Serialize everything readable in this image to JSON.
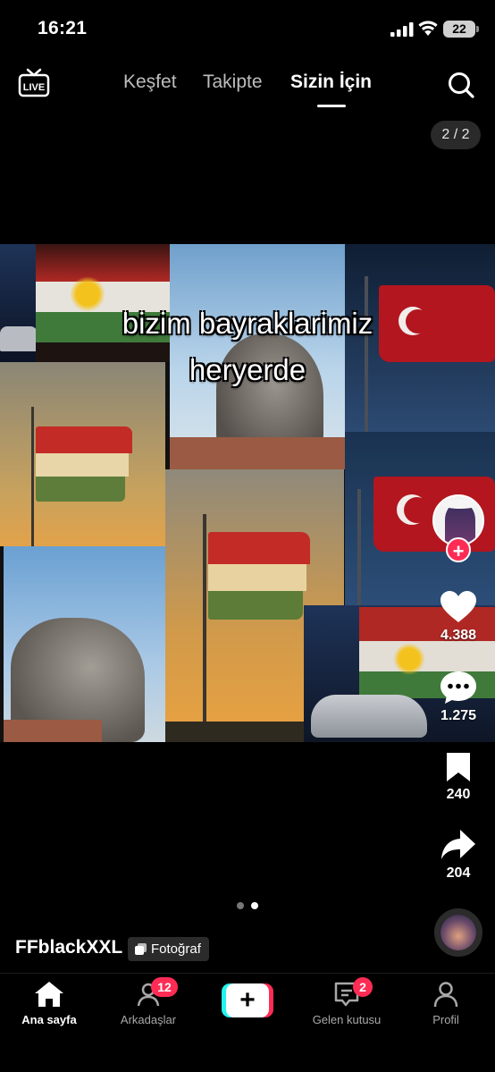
{
  "status_bar": {
    "time": "16:21",
    "battery": "22"
  },
  "top_nav": {
    "live_label": "LIVE",
    "tabs": [
      {
        "label": "Keşfet",
        "active": false
      },
      {
        "label": "Takipte",
        "active": false
      },
      {
        "label": "Sizin İçin",
        "active": true
      }
    ]
  },
  "post": {
    "page_counter": "2 / 2",
    "caption_line1": "bizim bayraklarimiz",
    "caption_line2": "heryerde",
    "author": "FFblackXXL",
    "type_badge": "Fotoğraf",
    "carousel": {
      "total": 2,
      "current": 2
    }
  },
  "actions": {
    "likes": "4.388",
    "comments": "1.275",
    "saves": "240",
    "shares": "204"
  },
  "bottom_nav": {
    "home": "Ana sayfa",
    "friends": "Arkadaşlar",
    "friends_badge": "12",
    "inbox": "Gelen kutusu",
    "inbox_badge": "2",
    "profile": "Profil",
    "create": "+"
  },
  "colors": {
    "accent": "#fe2c55",
    "accent_cyan": "#25f4ee",
    "background": "#000000"
  }
}
